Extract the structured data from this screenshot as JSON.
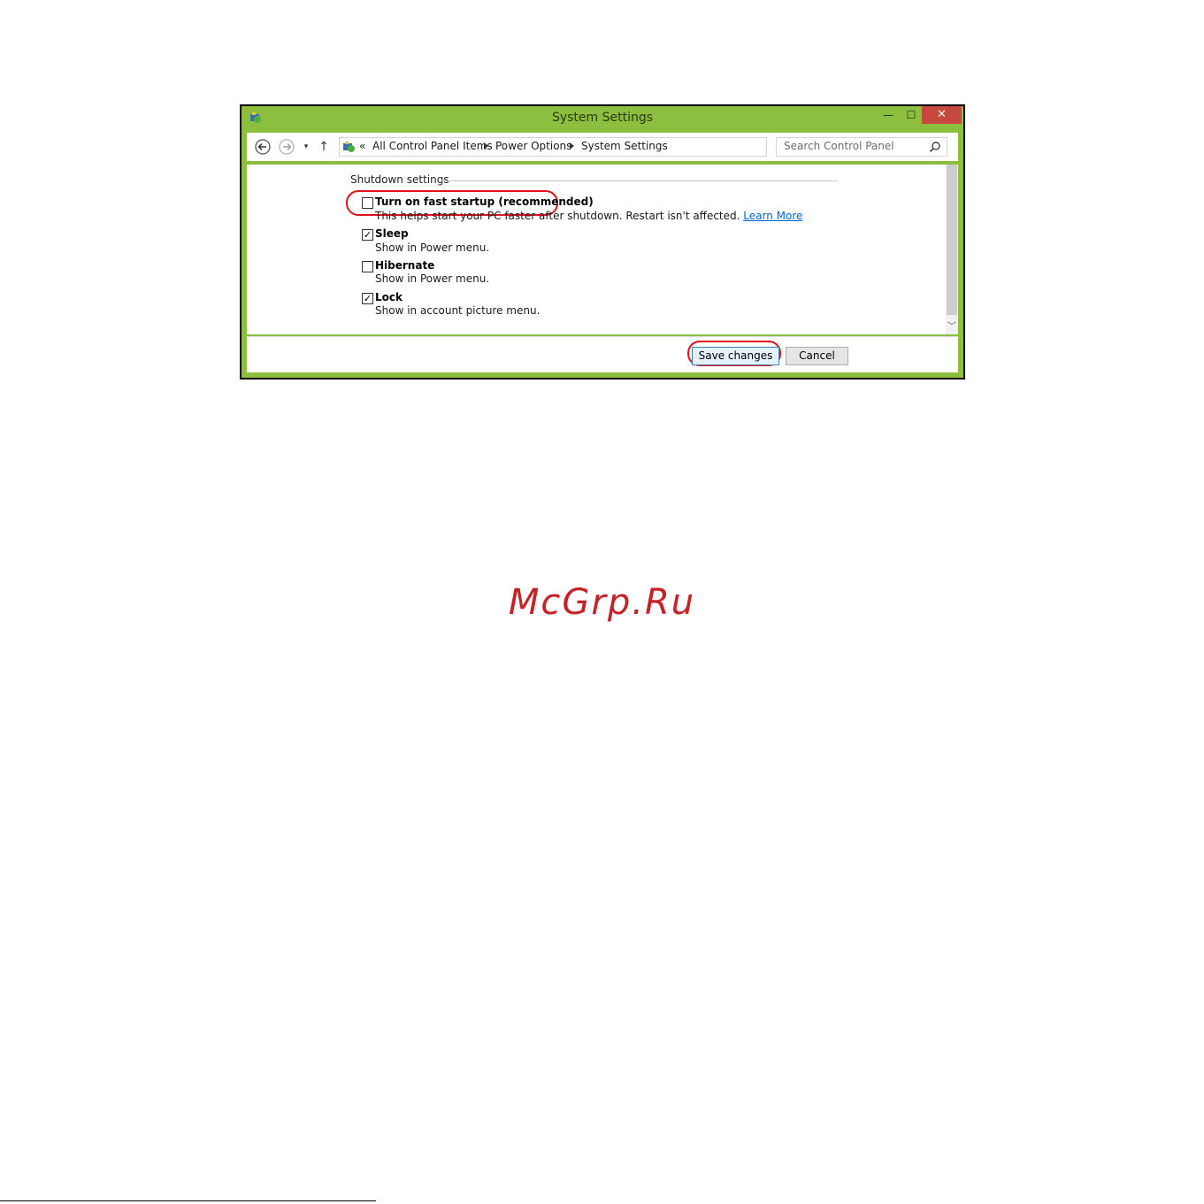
{
  "window": {
    "title": "System Settings",
    "accent": "#8cbf3f"
  },
  "caption": {
    "minimize": "—",
    "maximize": "☐",
    "close": "✕"
  },
  "addressbar": {
    "back_icon": "back-arrow-icon",
    "forward_icon": "forward-arrow-icon",
    "recent_icon": "▾",
    "up_icon": "↑",
    "overflow": "«",
    "crumbs": [
      "All Control Panel Items",
      "Power Options",
      "System Settings"
    ],
    "dropdown_icon": "⌄",
    "refresh_icon": "↻",
    "search_placeholder": "Search Control Panel"
  },
  "shutdown": {
    "heading": "Shutdown settings",
    "options": [
      {
        "label": "Turn on fast startup (recommended)",
        "checked": false,
        "desc": "This helps start your PC faster after shutdown. Restart isn't affected.",
        "link": "Learn More"
      },
      {
        "label": "Sleep",
        "checked": true,
        "desc": "Show in Power menu."
      },
      {
        "label": "Hibernate",
        "checked": false,
        "desc": "Show in Power menu."
      },
      {
        "label": "Lock",
        "checked": true,
        "desc": "Show in account picture menu."
      }
    ]
  },
  "footer": {
    "save": "Save changes",
    "cancel": "Cancel"
  },
  "watermark": "McGrp.Ru",
  "highlight_color": "#e0121b"
}
